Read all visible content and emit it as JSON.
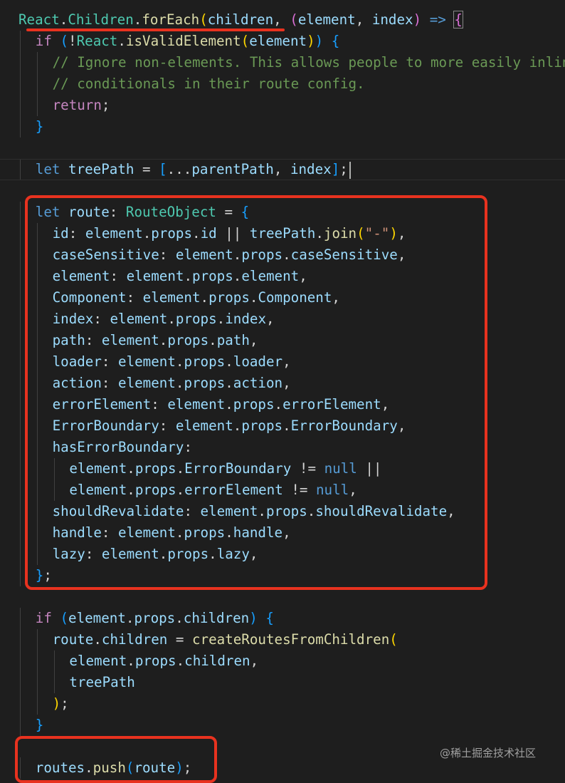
{
  "editor": {
    "lines": [
      [
        {
          "t": "React",
          "c": "ty"
        },
        {
          "t": ".",
          "c": "pl"
        },
        {
          "t": "Children",
          "c": "ty"
        },
        {
          "t": ".",
          "c": "pl"
        },
        {
          "t": "forEach",
          "c": "fn"
        },
        {
          "t": "(",
          "c": "p1"
        },
        {
          "t": "children",
          "c": "vr"
        },
        {
          "t": ", ",
          "c": "pl"
        },
        {
          "t": "(",
          "c": "p2"
        },
        {
          "t": "element",
          "c": "vr"
        },
        {
          "t": ", ",
          "c": "pl"
        },
        {
          "t": "index",
          "c": "vr"
        },
        {
          "t": ")",
          "c": "p2"
        },
        {
          "t": " ",
          "c": "pl"
        },
        {
          "t": "=>",
          "c": "kw"
        },
        {
          "t": " ",
          "c": "pl"
        },
        {
          "t": "{",
          "c": "p2",
          "box": true
        }
      ],
      [
        {
          "t": "if",
          "c": "ctl"
        },
        {
          "t": " ",
          "c": "pl"
        },
        {
          "t": "(",
          "c": "p3"
        },
        {
          "t": "!",
          "c": "pl"
        },
        {
          "t": "React",
          "c": "ty"
        },
        {
          "t": ".",
          "c": "pl"
        },
        {
          "t": "isValidElement",
          "c": "fn"
        },
        {
          "t": "(",
          "c": "p1"
        },
        {
          "t": "element",
          "c": "vr"
        },
        {
          "t": ")",
          "c": "p1"
        },
        {
          "t": ")",
          "c": "p3"
        },
        {
          "t": " ",
          "c": "pl"
        },
        {
          "t": "{",
          "c": "p3"
        }
      ],
      [
        {
          "t": "// Ignore non-elements. This allows people to more easily inline",
          "c": "cm"
        }
      ],
      [
        {
          "t": "// conditionals in their route config.",
          "c": "cm"
        }
      ],
      [
        {
          "t": "return",
          "c": "ctl"
        },
        {
          "t": ";",
          "c": "pl"
        }
      ],
      [
        {
          "t": "}",
          "c": "p3"
        }
      ],
      [],
      [
        {
          "t": "let",
          "c": "kw"
        },
        {
          "t": " ",
          "c": "pl"
        },
        {
          "t": "treePath",
          "c": "vr"
        },
        {
          "t": " = ",
          "c": "pl"
        },
        {
          "t": "[",
          "c": "p3"
        },
        {
          "t": "...",
          "c": "pl"
        },
        {
          "t": "parentPath",
          "c": "vr"
        },
        {
          "t": ", ",
          "c": "pl"
        },
        {
          "t": "index",
          "c": "vr"
        },
        {
          "t": "]",
          "c": "p3"
        },
        {
          "t": ";",
          "c": "pl"
        }
      ],
      [],
      [
        {
          "t": "let",
          "c": "kw"
        },
        {
          "t": " ",
          "c": "pl"
        },
        {
          "t": "route",
          "c": "vr"
        },
        {
          "t": ": ",
          "c": "pl"
        },
        {
          "t": "RouteObject",
          "c": "ty"
        },
        {
          "t": " = ",
          "c": "pl"
        },
        {
          "t": "{",
          "c": "p3"
        }
      ],
      [
        {
          "t": "id",
          "c": "vr"
        },
        {
          "t": ": ",
          "c": "pl"
        },
        {
          "t": "element",
          "c": "vr"
        },
        {
          "t": ".",
          "c": "pl"
        },
        {
          "t": "props",
          "c": "vr"
        },
        {
          "t": ".",
          "c": "pl"
        },
        {
          "t": "id",
          "c": "vr"
        },
        {
          "t": " || ",
          "c": "pl"
        },
        {
          "t": "treePath",
          "c": "vr"
        },
        {
          "t": ".",
          "c": "pl"
        },
        {
          "t": "join",
          "c": "fn"
        },
        {
          "t": "(",
          "c": "p1"
        },
        {
          "t": "\"-\"",
          "c": "str"
        },
        {
          "t": ")",
          "c": "p1"
        },
        {
          "t": ",",
          "c": "pl"
        }
      ],
      [
        {
          "t": "caseSensitive",
          "c": "vr"
        },
        {
          "t": ": ",
          "c": "pl"
        },
        {
          "t": "element",
          "c": "vr"
        },
        {
          "t": ".",
          "c": "pl"
        },
        {
          "t": "props",
          "c": "vr"
        },
        {
          "t": ".",
          "c": "pl"
        },
        {
          "t": "caseSensitive",
          "c": "vr"
        },
        {
          "t": ",",
          "c": "pl"
        }
      ],
      [
        {
          "t": "element",
          "c": "vr"
        },
        {
          "t": ": ",
          "c": "pl"
        },
        {
          "t": "element",
          "c": "vr"
        },
        {
          "t": ".",
          "c": "pl"
        },
        {
          "t": "props",
          "c": "vr"
        },
        {
          "t": ".",
          "c": "pl"
        },
        {
          "t": "element",
          "c": "vr"
        },
        {
          "t": ",",
          "c": "pl"
        }
      ],
      [
        {
          "t": "Component",
          "c": "vr"
        },
        {
          "t": ": ",
          "c": "pl"
        },
        {
          "t": "element",
          "c": "vr"
        },
        {
          "t": ".",
          "c": "pl"
        },
        {
          "t": "props",
          "c": "vr"
        },
        {
          "t": ".",
          "c": "pl"
        },
        {
          "t": "Component",
          "c": "vr"
        },
        {
          "t": ",",
          "c": "pl"
        }
      ],
      [
        {
          "t": "index",
          "c": "vr"
        },
        {
          "t": ": ",
          "c": "pl"
        },
        {
          "t": "element",
          "c": "vr"
        },
        {
          "t": ".",
          "c": "pl"
        },
        {
          "t": "props",
          "c": "vr"
        },
        {
          "t": ".",
          "c": "pl"
        },
        {
          "t": "index",
          "c": "vr"
        },
        {
          "t": ",",
          "c": "pl"
        }
      ],
      [
        {
          "t": "path",
          "c": "vr"
        },
        {
          "t": ": ",
          "c": "pl"
        },
        {
          "t": "element",
          "c": "vr"
        },
        {
          "t": ".",
          "c": "pl"
        },
        {
          "t": "props",
          "c": "vr"
        },
        {
          "t": ".",
          "c": "pl"
        },
        {
          "t": "path",
          "c": "vr"
        },
        {
          "t": ",",
          "c": "pl"
        }
      ],
      [
        {
          "t": "loader",
          "c": "vr"
        },
        {
          "t": ": ",
          "c": "pl"
        },
        {
          "t": "element",
          "c": "vr"
        },
        {
          "t": ".",
          "c": "pl"
        },
        {
          "t": "props",
          "c": "vr"
        },
        {
          "t": ".",
          "c": "pl"
        },
        {
          "t": "loader",
          "c": "vr"
        },
        {
          "t": ",",
          "c": "pl"
        }
      ],
      [
        {
          "t": "action",
          "c": "vr"
        },
        {
          "t": ": ",
          "c": "pl"
        },
        {
          "t": "element",
          "c": "vr"
        },
        {
          "t": ".",
          "c": "pl"
        },
        {
          "t": "props",
          "c": "vr"
        },
        {
          "t": ".",
          "c": "pl"
        },
        {
          "t": "action",
          "c": "vr"
        },
        {
          "t": ",",
          "c": "pl"
        }
      ],
      [
        {
          "t": "errorElement",
          "c": "vr"
        },
        {
          "t": ": ",
          "c": "pl"
        },
        {
          "t": "element",
          "c": "vr"
        },
        {
          "t": ".",
          "c": "pl"
        },
        {
          "t": "props",
          "c": "vr"
        },
        {
          "t": ".",
          "c": "pl"
        },
        {
          "t": "errorElement",
          "c": "vr"
        },
        {
          "t": ",",
          "c": "pl"
        }
      ],
      [
        {
          "t": "ErrorBoundary",
          "c": "vr"
        },
        {
          "t": ": ",
          "c": "pl"
        },
        {
          "t": "element",
          "c": "vr"
        },
        {
          "t": ".",
          "c": "pl"
        },
        {
          "t": "props",
          "c": "vr"
        },
        {
          "t": ".",
          "c": "pl"
        },
        {
          "t": "ErrorBoundary",
          "c": "vr"
        },
        {
          "t": ",",
          "c": "pl"
        }
      ],
      [
        {
          "t": "hasErrorBoundary",
          "c": "vr"
        },
        {
          "t": ":",
          "c": "pl"
        }
      ],
      [
        {
          "t": "element",
          "c": "vr"
        },
        {
          "t": ".",
          "c": "pl"
        },
        {
          "t": "props",
          "c": "vr"
        },
        {
          "t": ".",
          "c": "pl"
        },
        {
          "t": "ErrorBoundary",
          "c": "vr"
        },
        {
          "t": " != ",
          "c": "pl"
        },
        {
          "t": "null",
          "c": "kw"
        },
        {
          "t": " ||",
          "c": "pl"
        }
      ],
      [
        {
          "t": "element",
          "c": "vr"
        },
        {
          "t": ".",
          "c": "pl"
        },
        {
          "t": "props",
          "c": "vr"
        },
        {
          "t": ".",
          "c": "pl"
        },
        {
          "t": "errorElement",
          "c": "vr"
        },
        {
          "t": " != ",
          "c": "pl"
        },
        {
          "t": "null",
          "c": "kw"
        },
        {
          "t": ",",
          "c": "pl"
        }
      ],
      [
        {
          "t": "shouldRevalidate",
          "c": "vr"
        },
        {
          "t": ": ",
          "c": "pl"
        },
        {
          "t": "element",
          "c": "vr"
        },
        {
          "t": ".",
          "c": "pl"
        },
        {
          "t": "props",
          "c": "vr"
        },
        {
          "t": ".",
          "c": "pl"
        },
        {
          "t": "shouldRevalidate",
          "c": "vr"
        },
        {
          "t": ",",
          "c": "pl"
        }
      ],
      [
        {
          "t": "handle",
          "c": "vr"
        },
        {
          "t": ": ",
          "c": "pl"
        },
        {
          "t": "element",
          "c": "vr"
        },
        {
          "t": ".",
          "c": "pl"
        },
        {
          "t": "props",
          "c": "vr"
        },
        {
          "t": ".",
          "c": "pl"
        },
        {
          "t": "handle",
          "c": "vr"
        },
        {
          "t": ",",
          "c": "pl"
        }
      ],
      [
        {
          "t": "lazy",
          "c": "vr"
        },
        {
          "t": ": ",
          "c": "pl"
        },
        {
          "t": "element",
          "c": "vr"
        },
        {
          "t": ".",
          "c": "pl"
        },
        {
          "t": "props",
          "c": "vr"
        },
        {
          "t": ".",
          "c": "pl"
        },
        {
          "t": "lazy",
          "c": "vr"
        },
        {
          "t": ",",
          "c": "pl"
        }
      ],
      [
        {
          "t": "}",
          "c": "p3"
        },
        {
          "t": ";",
          "c": "pl"
        }
      ],
      [],
      [
        {
          "t": "if",
          "c": "ctl"
        },
        {
          "t": " ",
          "c": "pl"
        },
        {
          "t": "(",
          "c": "p3"
        },
        {
          "t": "element",
          "c": "vr"
        },
        {
          "t": ".",
          "c": "pl"
        },
        {
          "t": "props",
          "c": "vr"
        },
        {
          "t": ".",
          "c": "pl"
        },
        {
          "t": "children",
          "c": "vr"
        },
        {
          "t": ")",
          "c": "p3"
        },
        {
          "t": " ",
          "c": "pl"
        },
        {
          "t": "{",
          "c": "p3"
        }
      ],
      [
        {
          "t": "route",
          "c": "vr"
        },
        {
          "t": ".",
          "c": "pl"
        },
        {
          "t": "children",
          "c": "vr"
        },
        {
          "t": " = ",
          "c": "pl"
        },
        {
          "t": "createRoutesFromChildren",
          "c": "fn"
        },
        {
          "t": "(",
          "c": "p1"
        }
      ],
      [
        {
          "t": "element",
          "c": "vr"
        },
        {
          "t": ".",
          "c": "pl"
        },
        {
          "t": "props",
          "c": "vr"
        },
        {
          "t": ".",
          "c": "pl"
        },
        {
          "t": "children",
          "c": "vr"
        },
        {
          "t": ",",
          "c": "pl"
        }
      ],
      [
        {
          "t": "treePath",
          "c": "vr"
        }
      ],
      [
        {
          "t": ")",
          "c": "p1"
        },
        {
          "t": ";",
          "c": "pl"
        }
      ],
      [
        {
          "t": "}",
          "c": "p3"
        }
      ],
      [],
      [
        {
          "t": "routes",
          "c": "vr"
        },
        {
          "t": ".",
          "c": "pl"
        },
        {
          "t": "push",
          "c": "fn"
        },
        {
          "t": "(",
          "c": "p3"
        },
        {
          "t": "route",
          "c": "vr"
        },
        {
          "t": ")",
          "c": "p3"
        },
        {
          "t": ";",
          "c": "pl"
        }
      ]
    ]
  },
  "watermark": "@稀土掘金技术社区"
}
